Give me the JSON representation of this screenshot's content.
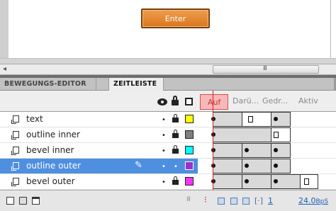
{
  "stage": {
    "button_label": "Enter",
    "button_color": "#e2852e"
  },
  "scrollbar": {
    "left_arrow": "◂",
    "grip": "III"
  },
  "tabs": [
    {
      "label": "BEWEGUNGS-EDITOR",
      "active": false
    },
    {
      "label": "ZEITLEISTE",
      "active": true
    }
  ],
  "header": {
    "eye_icon": "eye-icon",
    "lock_icon": "lock-icon",
    "outline_icon": "outline-icon",
    "frame_labels": [
      "Auf",
      "Darü...",
      "Gedr...",
      "Aktiv"
    ]
  },
  "layers": [
    {
      "name": "text",
      "visible_mark": "•",
      "locked": true,
      "color": "#ffff00",
      "selected": false
    },
    {
      "name": "outline inner",
      "visible_mark": "•",
      "locked": true,
      "color": "#7f7f7f",
      "selected": false
    },
    {
      "name": "bevel inner",
      "visible_mark": "•",
      "locked": true,
      "color": "#00ffff",
      "selected": false
    },
    {
      "name": "outline outer",
      "visible_mark": "•",
      "locked": false,
      "lock_mark": "•",
      "color": "#9b30d0",
      "selected": true,
      "editing": true
    },
    {
      "name": "bevel outer",
      "visible_mark": "•",
      "locked": true,
      "color": "#ff33ff",
      "selected": false
    }
  ],
  "footer": {
    "playhead_icon": "playhead-icon",
    "markers": "[·]",
    "current_frame": "1",
    "fps": "24.0",
    "fps_unit": "BpS"
  }
}
